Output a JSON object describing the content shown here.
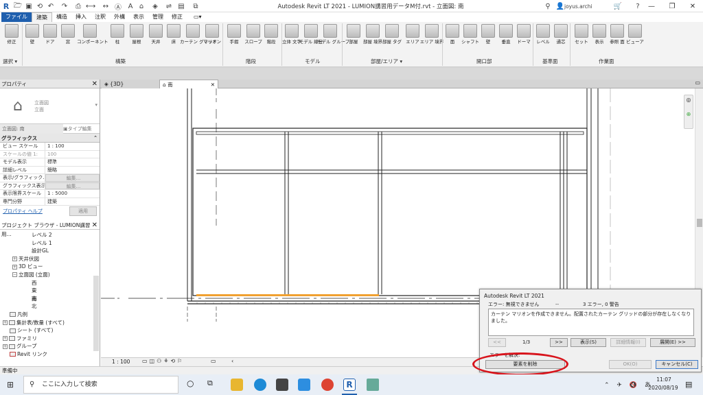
{
  "window": {
    "title": "Autodesk Revit LT 2021 - LUMION講習用データM付.rvt - 立面図: 南",
    "user": "joyus.archi"
  },
  "menu": {
    "tabs": [
      "ファイル",
      "建築",
      "構造",
      "挿入",
      "注釈",
      "外構",
      "表示",
      "管理",
      "修正"
    ]
  },
  "ribbon": {
    "buttons": [
      "修正",
      "壁",
      "ドア",
      "窓",
      "コンポーネント",
      "柱",
      "屋根",
      "天井",
      "床",
      "カーテン グリッド",
      "マリオン",
      "手摺",
      "スロープ",
      "階段",
      "立体 文字",
      "モデル 線分",
      "モデル グループ",
      "部屋",
      "部屋 境界",
      "部屋 タグ",
      "エリア",
      "エリア 境界",
      "面",
      "シャフト",
      "壁",
      "垂直",
      "ドーマ",
      "レベル",
      "通芯",
      "セット",
      "表示",
      "参照 面",
      "ビューア"
    ],
    "panels": [
      "選択 ▾",
      "構築",
      "階段",
      "モデル",
      "部屋/エリア ▾",
      "開口部",
      "基準面",
      "作業面"
    ]
  },
  "properties": {
    "title": "プロパティ",
    "type_name_1": "立面図",
    "type_name_2": "立面",
    "selector": "立面図: 南",
    "edit_type": "タイプ編集",
    "section": "グラフィックス",
    "rows": [
      {
        "k": "ビュー スケール",
        "v": "1 : 100"
      },
      {
        "k": "スケールの値   1:",
        "v": "100"
      },
      {
        "k": "モデル表示",
        "v": "標準"
      },
      {
        "k": "詳細レベル",
        "v": "簡略"
      },
      {
        "k": "表示/グラフィック...",
        "v": "編集..."
      },
      {
        "k": "グラフィックス表示...",
        "v": "編集..."
      },
      {
        "k": "表示限界スケール",
        "v": "1 : 5000"
      },
      {
        "k": "専門分野",
        "v": "建築"
      }
    ],
    "help": "プロパティ ヘルプ",
    "apply": "適用"
  },
  "browser": {
    "title": "プロジェクト ブラウザ - LUMION講習用...",
    "items": [
      "レベル 2",
      "レベル 1",
      "設計GL",
      "天井伏図",
      "3D ビュー",
      "立面図 (立面)",
      "西",
      "東",
      "南",
      "北",
      "凡例",
      "集計表/数量 (すべて)",
      "シート (すべて)",
      "ファミリ",
      "グループ",
      "Revit リンク"
    ]
  },
  "views": {
    "tab1": "{3D}",
    "tab2": "南"
  },
  "viewbar": {
    "scale": "1 : 100"
  },
  "status": {
    "text": "準備中"
  },
  "dialog": {
    "title": "Autodesk Revit LT 2021",
    "error_label": "エラー: 無視できません",
    "dashes": "--",
    "count": "3 エラー, 0 警告",
    "message": "カーテン マリオンを作成できません。配置されたカーテン グリッドの部分が存在しなくなりました。",
    "prev": "<<",
    "pager": "1/3",
    "next": ">>",
    "show": "表示(S)",
    "info": "詳細情報(I)",
    "expand": "展開(E) >>",
    "resolve": "エラーを解決:",
    "delete": "要素を削除",
    "ok": "OK(O)",
    "cancel": "キャンセル(C)"
  },
  "taskbar": {
    "search_placeholder": "ここに入力して検索",
    "time": "11:07",
    "date": "2020/08/19"
  },
  "colors": {
    "accent": "#1f5fae",
    "highlight": "#f0a030",
    "annotation": "#d8141c"
  }
}
